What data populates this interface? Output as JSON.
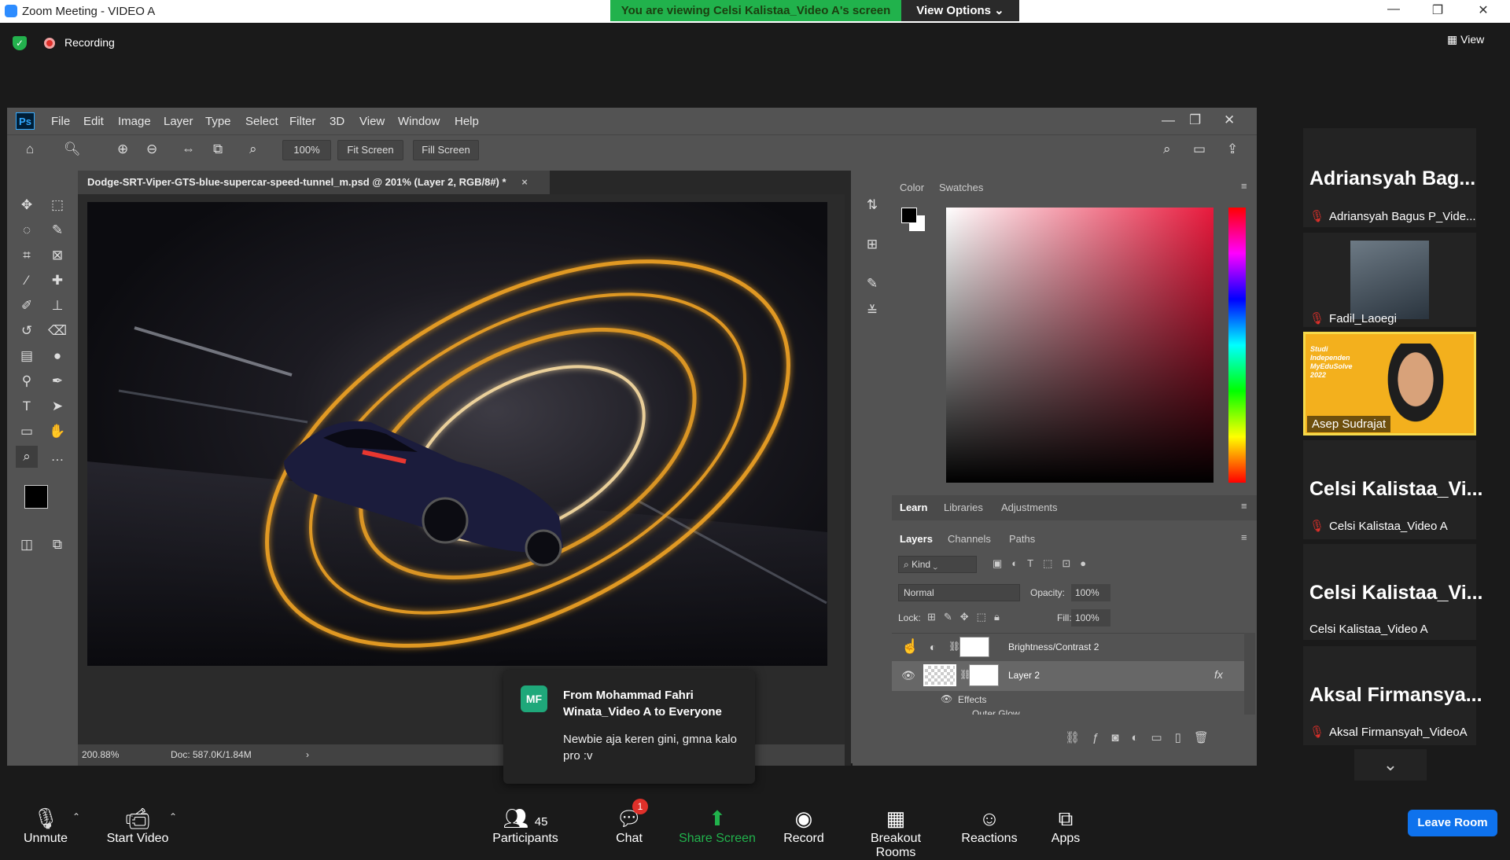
{
  "window": {
    "title": "Zoom Meeting - VIDEO A",
    "minimize": "—",
    "restore": "❐",
    "close": "✕"
  },
  "banner": {
    "viewing": "You are viewing Celsi Kalistaa_Video A's screen",
    "view_options": "View Options ⌄"
  },
  "topstrip": {
    "recording": "Recording",
    "view": "View"
  },
  "ps": {
    "logo": "Ps",
    "menu": [
      "File",
      "Edit",
      "Image",
      "Layer",
      "Type",
      "Select",
      "Filter",
      "3D",
      "View",
      "Window",
      "Help"
    ],
    "zoom_field": "100%",
    "fit_screen": "Fit Screen",
    "fill_screen": "Fill Screen",
    "doc_tab": "Dodge-SRT-Viper-GTS-blue-supercar-speed-tunnel_m.psd @ 201% (Layer 2, RGB/8#) *",
    "doc_tab_close": "×",
    "status_zoom": "200.88%",
    "status_doc": "Doc: 587.0K/1.84M",
    "color_tabs": [
      "Color",
      "Swatches"
    ],
    "learn_tabs": [
      "Learn",
      "Libraries",
      "Adjustments"
    ],
    "layer_tabs": [
      "Layers",
      "Channels",
      "Paths"
    ],
    "kind": "Kind",
    "blend_mode": "Normal",
    "opacity_label": "Opacity:",
    "opacity": "100%",
    "lock_label": "Lock:",
    "fill_label": "Fill:",
    "fill": "100%",
    "layers": [
      {
        "name": "Brightness/Contrast 2"
      },
      {
        "name": "Layer 2",
        "fx": "fx"
      }
    ],
    "effects_label": "Effects",
    "effect_sub": "Outer Glow"
  },
  "chat_toast": {
    "avatar": "MF",
    "from": "From Mohammad Fahri Winata_Video A to Everyone",
    "message": "Newbie aja keren gini, gmna kalo pro :v"
  },
  "participants": [
    {
      "big": "Adriansyah  Bag...",
      "sub": "Adriansyah Bagus P_Vide...",
      "muted": true
    },
    {
      "big": "",
      "sub": "Fadil_Laoegi",
      "muted": true
    },
    {
      "big": "",
      "sub": "Asep Sudrajat",
      "muted": false
    },
    {
      "big": "Celsi  Kalistaa_Vi...",
      "sub": "Celsi Kalistaa_Video A",
      "muted": true
    },
    {
      "big": "Celsi  Kalistaa_Vi...",
      "sub": "Celsi Kalistaa_Video A",
      "muted": false
    },
    {
      "big": "Aksal  Firmansya...",
      "sub": "Aksal Firmansyah_VideoA",
      "muted": true
    }
  ],
  "tile_slide_text": "Studi Independen MyEduSolve 2022",
  "bottombar": {
    "unmute": "Unmute",
    "start_video": "Start Video",
    "participants": "Participants",
    "participants_count": "45",
    "chat": "Chat",
    "chat_badge": "1",
    "share_screen": "Share Screen",
    "record": "Record",
    "breakout": "Breakout Rooms",
    "reactions": "Reactions",
    "apps": "Apps",
    "leave": "Leave Room"
  },
  "colors": {
    "zoom_green": "#21b24c",
    "leave_blue": "#0e72ed",
    "mute_red": "#e0302a",
    "ps_gray": "#535353",
    "glow_orange": "#f5a623"
  }
}
